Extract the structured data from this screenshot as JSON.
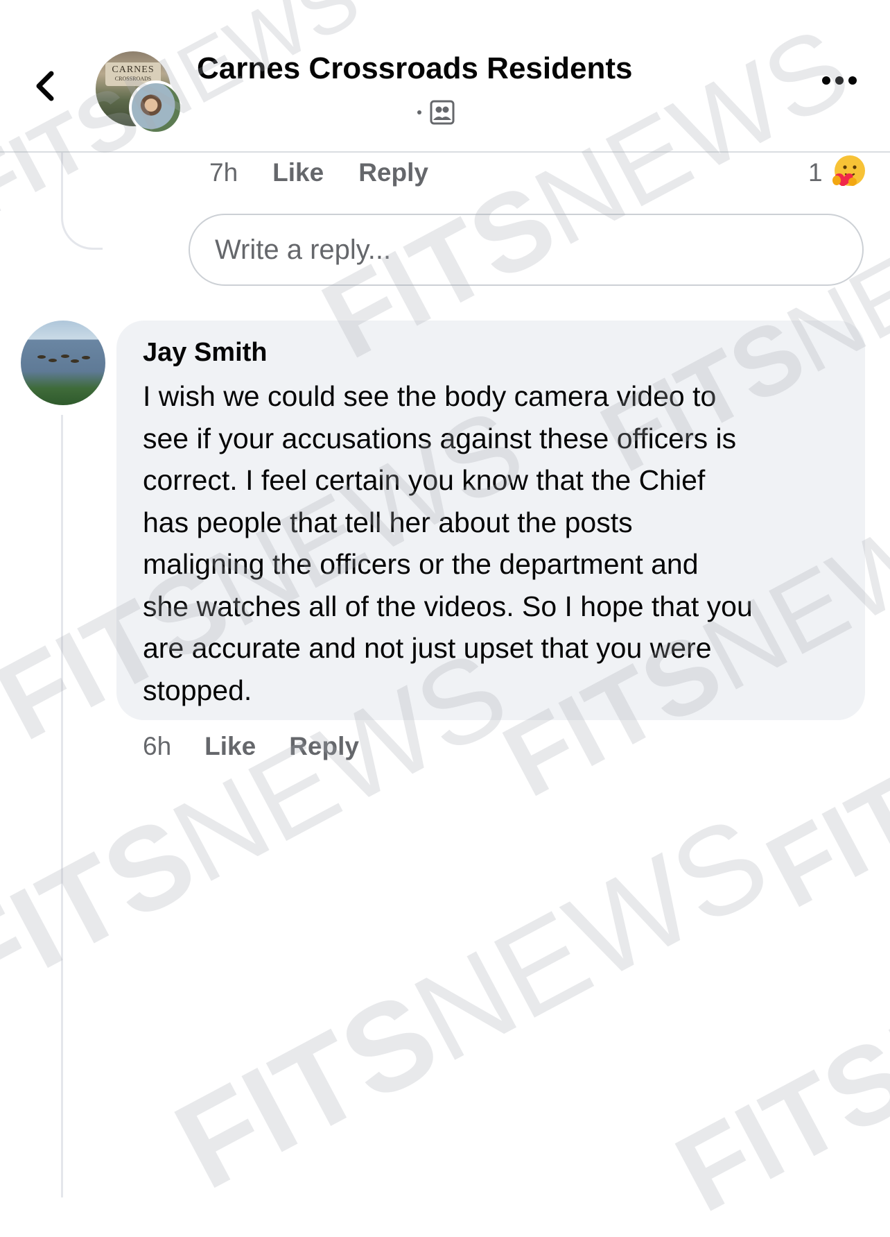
{
  "header": {
    "back_icon": "chevron-left-icon",
    "group_avatar_text_line1": "CARNES",
    "group_avatar_text_line2": "CROSSROADS",
    "title": "Carnes Crossroads Residents",
    "privacy_icon": "group-members-icon",
    "more_icon": "more-horizontal-icon"
  },
  "previous_comment": {
    "time": "7h",
    "like_label": "Like",
    "reply_label": "Reply",
    "reaction_count": "1",
    "reaction_icon": "care-emoji-icon"
  },
  "reply_box": {
    "placeholder": "Write a reply..."
  },
  "comment": {
    "author": "Jay Smith",
    "lines": [
      "I wish we could see the body camera video to",
      "see if your accusations against these officers is",
      "correct.  I feel certain you know that the Chief",
      "has people that tell her about the posts",
      "maligning the officers or the department and",
      "she watches all of the videos.  So I hope that you",
      "are accurate and not just upset that you were",
      "stopped."
    ],
    "time": "6h",
    "like_label": "Like",
    "reply_label": "Reply"
  },
  "watermark": {
    "bold": "FITS",
    "thin": "NEWS"
  }
}
